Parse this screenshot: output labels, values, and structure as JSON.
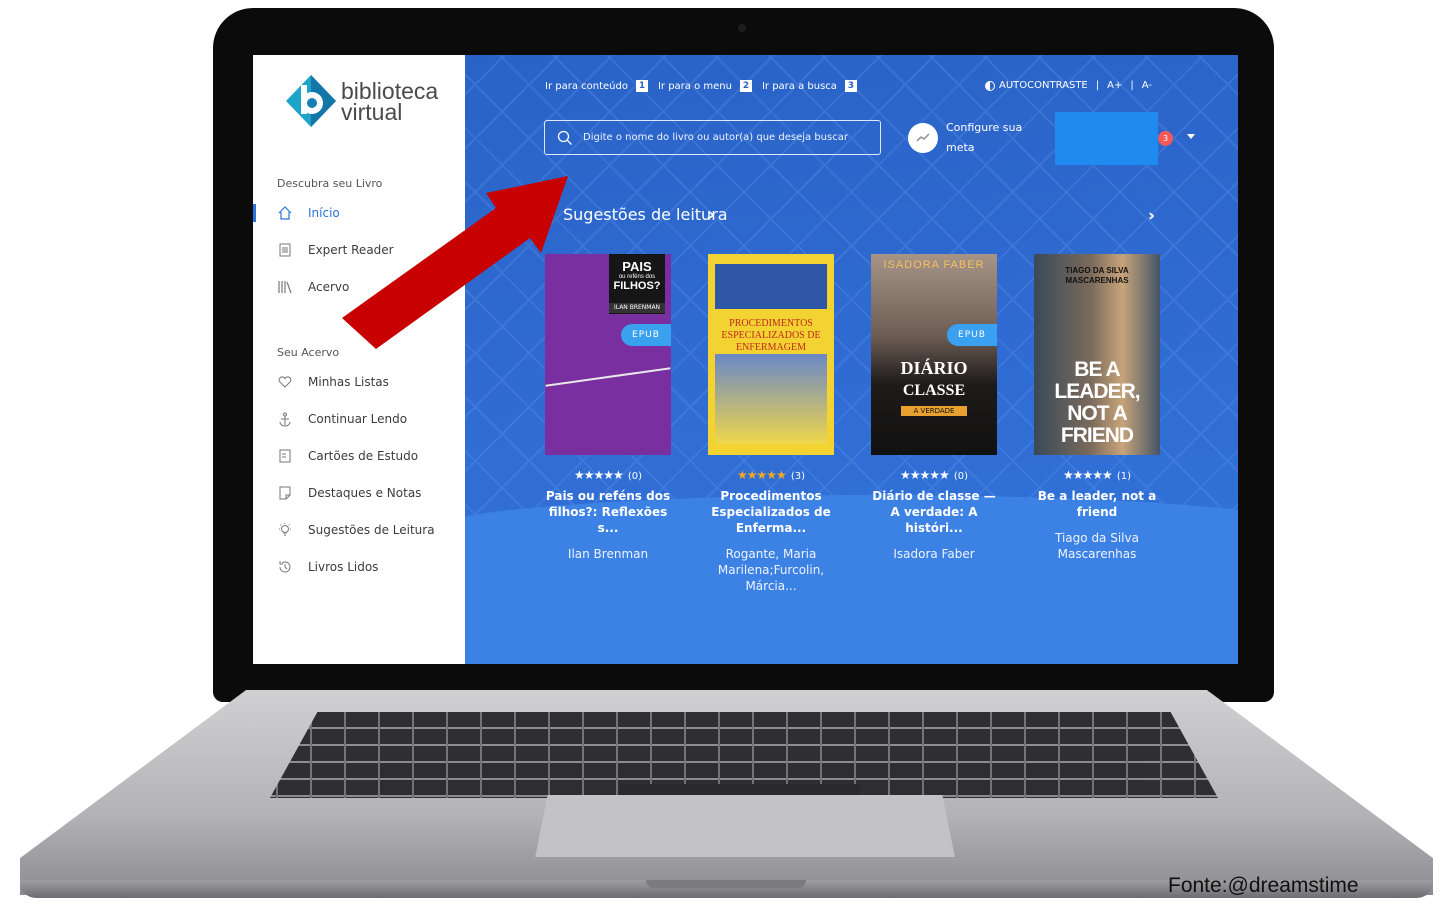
{
  "sidebar": {
    "logo_line1": "biblioteca",
    "logo_line2": "virtual",
    "section1_title": "Descubra seu Livro",
    "section1_items": [
      {
        "label": "Início",
        "icon": "home-icon",
        "active": true
      },
      {
        "label": "Expert Reader",
        "icon": "document-icon",
        "active": false
      },
      {
        "label": "Acervo",
        "icon": "bookshelf-icon",
        "active": false
      }
    ],
    "section2_title": "Seu Acervo",
    "section2_items": [
      {
        "label": "Minhas Listas",
        "icon": "heart-icon"
      },
      {
        "label": "Continuar Lendo",
        "icon": "anchor-icon"
      },
      {
        "label": "Cartões de Estudo",
        "icon": "card-icon"
      },
      {
        "label": "Destaques e Notas",
        "icon": "note-icon"
      },
      {
        "label": "Sugestões de Leitura",
        "icon": "lightbulb-icon"
      },
      {
        "label": "Livros Lidos",
        "icon": "history-icon"
      }
    ]
  },
  "topbar": {
    "skip_links": [
      {
        "label": "Ir para conteúdo",
        "key": "1"
      },
      {
        "label": "Ir para o menu",
        "key": "2"
      },
      {
        "label": "Ir para a busca",
        "key": "3"
      }
    ],
    "contrast_label": "AUTOCONTRASTE",
    "font_increase": "A+",
    "font_decrease": "A-",
    "separator": "|"
  },
  "search": {
    "placeholder": "Digite o nome do livro ou autor(a) que deseja buscar"
  },
  "goal": {
    "label": "Configure sua meta"
  },
  "notifications": {
    "count": "3"
  },
  "suggestions": {
    "title": "Sugestões de leitura",
    "books": [
      {
        "title": "Pais ou reféns dos filhos?: Reflexões s...",
        "author": "Ilan Brenman",
        "rating_count": "(0)",
        "stars": "★★★★★",
        "badge": "EPUB",
        "cover_lines": [
          "PAIS",
          "ou reféns dos",
          "FILHOS?",
          "ILAN BRENMAN"
        ]
      },
      {
        "title": "Procedimentos Especializados de Enferma...",
        "author": "Rogante, Maria Marilena;Furcolin, Márcia...",
        "rating_count": "(3)",
        "stars": "★★★★★",
        "badge": "",
        "cover_lines": [
          "PROCEDIMENTOS ESPECIALIZADOS DE ENFERMAGEM"
        ]
      },
      {
        "title": "Diário de classe — A verdade: A históri...",
        "author": "Isadora Faber",
        "rating_count": "(0)",
        "stars": "★★★★★",
        "badge": "EPUB",
        "cover_lines": [
          "ISADORA FABER",
          "DIÁRIO",
          "CLASSE",
          "A VERDADE"
        ]
      },
      {
        "title": "Be a leader, not a friend",
        "author": "Tiago da Silva Mascarenhas",
        "rating_count": "(1)",
        "stars": "★★★★★",
        "badge": "",
        "cover_lines": [
          "TIAGO DA SILVA MASCARENHAS",
          "BE A LEADER, NOT A FRIEND"
        ]
      }
    ]
  },
  "caption": "Fonte:@dreamstime",
  "colors": {
    "main_bg": "#2f6bd2",
    "accent": "#2b73d9",
    "arrow": "#c80000",
    "badge": "#f25a5a",
    "epub": "#3aa0f0"
  }
}
